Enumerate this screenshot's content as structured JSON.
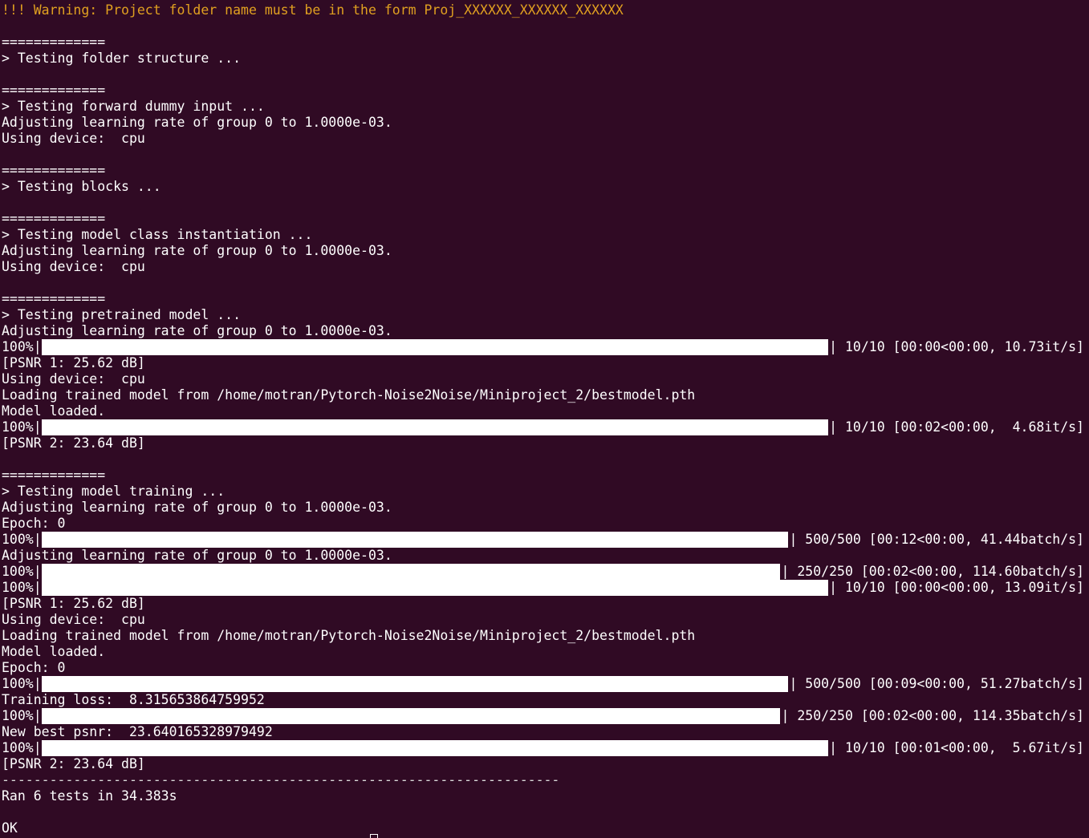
{
  "terminal": {
    "background": "#300a24",
    "foreground": "#ffffff",
    "warning_color": "#e0a020",
    "lines": [
      {
        "type": "text",
        "style": "warn",
        "text": "!!! Warning: Project folder name must be in the form Proj_XXXXXX_XXXXXX_XXXXXX"
      },
      {
        "type": "text",
        "text": ""
      },
      {
        "type": "text",
        "text": "============="
      },
      {
        "type": "text",
        "text": "> Testing folder structure ..."
      },
      {
        "type": "text",
        "text": ""
      },
      {
        "type": "text",
        "text": "============="
      },
      {
        "type": "text",
        "text": "> Testing forward dummy input ..."
      },
      {
        "type": "text",
        "text": "Adjusting learning rate of group 0 to 1.0000e-03."
      },
      {
        "type": "text",
        "text": "Using device:  cpu"
      },
      {
        "type": "text",
        "text": ""
      },
      {
        "type": "text",
        "text": "============="
      },
      {
        "type": "text",
        "text": "> Testing blocks ..."
      },
      {
        "type": "text",
        "text": ""
      },
      {
        "type": "text",
        "text": "============="
      },
      {
        "type": "text",
        "text": "> Testing model class instantiation ..."
      },
      {
        "type": "text",
        "text": "Adjusting learning rate of group 0 to 1.0000e-03."
      },
      {
        "type": "text",
        "text": "Using device:  cpu"
      },
      {
        "type": "text",
        "text": ""
      },
      {
        "type": "text",
        "text": "============="
      },
      {
        "type": "text",
        "text": "> Testing pretrained model ..."
      },
      {
        "type": "text",
        "text": "Adjusting learning rate of group 0 to 1.0000e-03."
      },
      {
        "type": "progress",
        "prefix": "100%|",
        "progress": 1.0,
        "bar_end": 1032,
        "suffix": "| 10/10 [00:00<00:00, 10.73it/s]"
      },
      {
        "type": "text",
        "text": "[PSNR 1: 25.62 dB]"
      },
      {
        "type": "text",
        "text": "Using device:  cpu"
      },
      {
        "type": "text",
        "text": "Loading trained model from /home/motran/Pytorch-Noise2Noise/Miniproject_2/bestmodel.pth"
      },
      {
        "type": "text",
        "text": "Model loaded."
      },
      {
        "type": "progress",
        "prefix": "100%|",
        "progress": 1.0,
        "bar_end": 1032,
        "suffix": "| 10/10 [00:02<00:00,  4.68it/s]"
      },
      {
        "type": "text",
        "text": "[PSNR 2: 23.64 dB]"
      },
      {
        "type": "text",
        "text": ""
      },
      {
        "type": "text",
        "text": "============="
      },
      {
        "type": "text",
        "text": "> Testing model training ..."
      },
      {
        "type": "text",
        "text": "Adjusting learning rate of group 0 to 1.0000e-03."
      },
      {
        "type": "text",
        "text": "Epoch: 0"
      },
      {
        "type": "progress",
        "prefix": "100%|",
        "progress": 1.0,
        "bar_end": 982,
        "suffix": "| 500/500 [00:12<00:00, 41.44batch/s]"
      },
      {
        "type": "text",
        "text": "Adjusting learning rate of group 0 to 1.0000e-03."
      },
      {
        "type": "progress",
        "prefix": "100%|",
        "progress": 1.0,
        "bar_end": 972,
        "suffix": "| 250/250 [00:02<00:00, 114.60batch/s]"
      },
      {
        "type": "progress",
        "prefix": "100%|",
        "progress": 1.0,
        "bar_end": 1032,
        "suffix": "| 10/10 [00:00<00:00, 13.09it/s]"
      },
      {
        "type": "text",
        "text": "[PSNR 1: 25.62 dB]"
      },
      {
        "type": "text",
        "text": "Using device:  cpu"
      },
      {
        "type": "text",
        "text": "Loading trained model from /home/motran/Pytorch-Noise2Noise/Miniproject_2/bestmodel.pth"
      },
      {
        "type": "text",
        "text": "Model loaded."
      },
      {
        "type": "text",
        "text": "Epoch: 0"
      },
      {
        "type": "progress",
        "prefix": "100%|",
        "progress": 1.0,
        "bar_end": 982,
        "suffix": "| 500/500 [00:09<00:00, 51.27batch/s]"
      },
      {
        "type": "text",
        "text": "Training loss:  8.315653864759952"
      },
      {
        "type": "progress",
        "prefix": "100%|",
        "progress": 1.0,
        "bar_end": 972,
        "suffix": "| 250/250 [00:02<00:00, 114.35batch/s]"
      },
      {
        "type": "text",
        "text": "New best psnr:  23.640165328979492"
      },
      {
        "type": "progress",
        "prefix": "100%|",
        "progress": 1.0,
        "bar_end": 1032,
        "suffix": "| 10/10 [00:01<00:00,  5.67it/s]"
      },
      {
        "type": "text",
        "text": "[PSNR 2: 23.64 dB]"
      },
      {
        "type": "text",
        "style": "faint",
        "text": "----------------------------------------------------------------------"
      },
      {
        "type": "text",
        "text": "Ran 6 tests in 34.383s"
      },
      {
        "type": "text",
        "text": ""
      },
      {
        "type": "text",
        "text": "OK"
      }
    ]
  }
}
